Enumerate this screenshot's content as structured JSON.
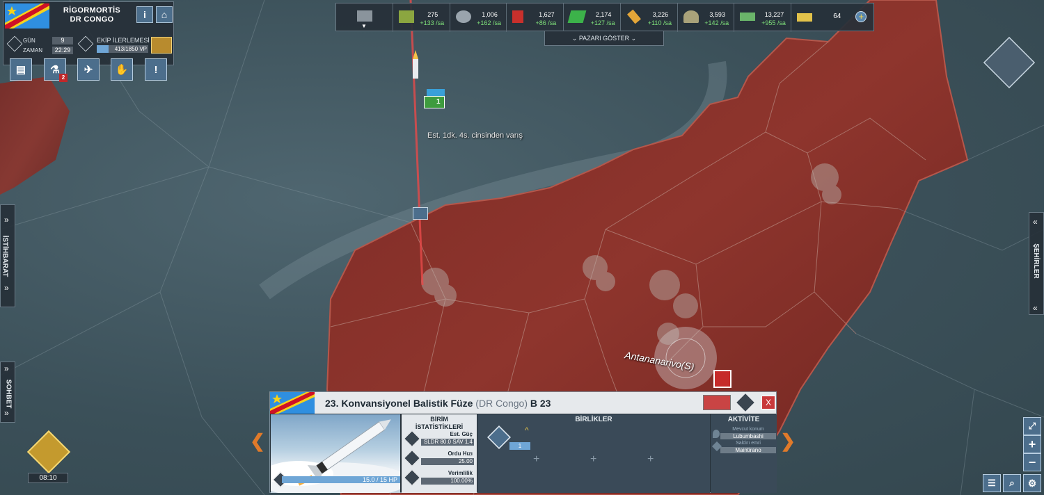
{
  "player": {
    "name": "RİGORMORTİS",
    "country": "DR CONGO",
    "day_label": "GÜN",
    "day_value": "9",
    "time_label": "ZAMAN",
    "time_value": "22:29",
    "team_label": "EKİP İLERLEMESİ",
    "team_value": "413/1850 VP",
    "team_progress": 0.223
  },
  "toolbar": {
    "info_label": "i",
    "home_label": "⌂",
    "alert_label": "!",
    "research_badge": "2"
  },
  "resources": [
    {
      "icon": "supplies-crate-icon",
      "amount": "275",
      "rate": "+133 /sa"
    },
    {
      "icon": "components-gear-icon",
      "amount": "1,006",
      "rate": "+162 /sa"
    },
    {
      "icon": "fuel-can-icon",
      "amount": "1,627",
      "rate": "+86 /sa"
    },
    {
      "icon": "electronics-chip-icon",
      "amount": "2,174",
      "rate": "+127 /sa"
    },
    {
      "icon": "rare-materials-icon",
      "amount": "3,226",
      "rate": "+110 /sa"
    },
    {
      "icon": "manpower-helmet-icon",
      "amount": "3,593",
      "rate": "+142 /sa"
    },
    {
      "icon": "money-bills-icon",
      "amount": "13,227",
      "rate": "+955 /sa"
    }
  ],
  "gold": {
    "amount": "64"
  },
  "market": {
    "label": "PAZARI GÖSTER"
  },
  "map": {
    "launch_text": "Est. 1dk. 4s. cinsinden varış",
    "city_label": "Antananarivo(S)",
    "unit_stack_count": "1"
  },
  "side_tabs": {
    "intel": "İSTİHBARAT",
    "chat": "SOHBET",
    "cities": "ŞEHİRLER"
  },
  "gold_timer": "08:10",
  "unit_panel": {
    "title": "23. Konvansiyonel Balistik Füze",
    "nation": "(DR Congo)",
    "code": "B 23",
    "close_label": "X",
    "hp": "15.0 / 15 HP",
    "hp_fraction": 1.0,
    "stats_title_1": "BİRİM",
    "stats_title_2": "İSTATİSTİKLERİ",
    "stats": [
      {
        "label": "Est. Güç",
        "value": "SLDR 80.0 SAV 1.4"
      },
      {
        "label": "Ordu Hızı",
        "value": "25.00"
      },
      {
        "label": "Verimlilik",
        "value": "100.00%"
      }
    ],
    "units_title": "BİRLİKLER",
    "unit_slot_count": "1",
    "activity_title": "AKTİVİTE",
    "activity": [
      {
        "label": "Mevcut konum",
        "value": "Lubumbashi"
      },
      {
        "label": "Saldırı emri",
        "value": "Maintirano"
      }
    ]
  },
  "colors": {
    "enemy_territory": "#8a2f28",
    "sea": "#3f5560",
    "accent_orange": "#e07a2a",
    "rate_green": "#7fe07a",
    "button_blue": "#4c6e8c"
  }
}
